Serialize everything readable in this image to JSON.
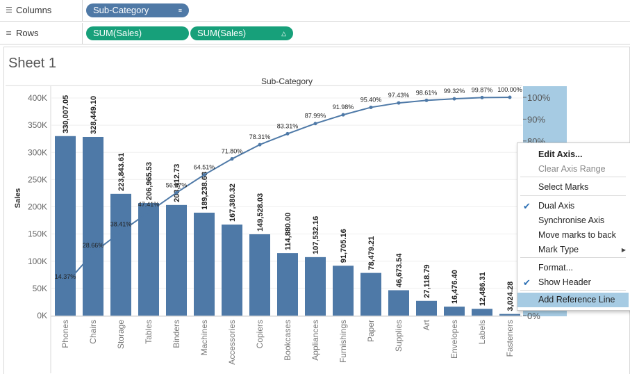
{
  "shelves": {
    "columns": {
      "label": "Columns",
      "icon": "columns-icon",
      "pills": [
        {
          "text": "Sub-Category",
          "icon": "sort-desc-icon"
        }
      ]
    },
    "rows": {
      "label": "Rows",
      "icon": "rows-icon",
      "pills": [
        {
          "text": "SUM(Sales)"
        },
        {
          "text": "SUM(Sales)",
          "icon": "triangle-icon"
        }
      ]
    }
  },
  "sheet": {
    "title": "Sheet 1"
  },
  "chart_data": {
    "type": "bar",
    "title": "Sub-Category",
    "ylabel": "Sales",
    "ylim": [
      0,
      400000
    ],
    "yticks": [
      "400K",
      "350K",
      "300K",
      "250K",
      "200K",
      "150K",
      "100K",
      "50K",
      "0K"
    ],
    "categories": [
      "Phones",
      "Chairs",
      "Storage",
      "Tables",
      "Binders",
      "Machines",
      "Accessories",
      "Copiers",
      "Bookcases",
      "Appliances",
      "Furnishings",
      "Paper",
      "Supplies",
      "Art",
      "Envelopes",
      "Labels",
      "Fasteners"
    ],
    "series": [
      {
        "values": [
          330007.05,
          328449.1,
          223843.61,
          206965.53,
          203412.73,
          189238.63,
          167380.32,
          149528.03,
          114880.0,
          107532.16,
          91705.16,
          78479.21,
          46673.54,
          27118.79,
          16476.4,
          12486.31,
          3024.28
        ],
        "labels": [
          "330,007.05",
          "328,449.10",
          "223,843.61",
          "206,965.53",
          "203,412.73",
          "189,238.63",
          "167,380.32",
          "149,528.03",
          "114,880.00",
          "107,532.16",
          "91,705.16",
          "78,479.21",
          "46,673.54",
          "27,118.79",
          "16,476.40",
          "12,486.31",
          "3,024.28"
        ]
      },
      {
        "values": [
          14.37,
          28.66,
          38.41,
          47.41,
          56.27,
          64.51,
          71.8,
          78.31,
          83.31,
          87.99,
          91.98,
          95.4,
          97.43,
          98.61,
          99.32,
          99.87,
          100.0
        ],
        "labels": [
          "14.37%",
          "28.66%",
          "38.41%",
          "47.41%",
          "56.27%",
          "64.51%",
          "71.80%",
          "78.31%",
          "83.31%",
          "87.99%",
          "91.98%",
          "95.40%",
          "97.43%",
          "98.61%",
          "99.32%",
          "99.87%",
          "100.00%"
        ]
      }
    ],
    "y2ticks": [
      "100%",
      "90%",
      "80%",
      "0%"
    ],
    "colors": {
      "bar": "#4e79a7",
      "line": "#4e79a7",
      "axis_selected": "#a6cbe3"
    }
  },
  "context_menu": {
    "items": [
      {
        "label": "Edit Axis...",
        "bold": true
      },
      {
        "label": "Clear Axis Range",
        "disabled": true
      },
      {
        "label": "Select Marks"
      },
      {
        "label": "Dual Axis",
        "checked": true
      },
      {
        "label": "Synchronise Axis"
      },
      {
        "label": "Move marks to back"
      },
      {
        "label": "Mark Type",
        "submenu": true
      },
      {
        "label": "Format..."
      },
      {
        "label": "Show Header",
        "checked": true
      },
      {
        "label": "Add Reference Line",
        "highlighted": true
      }
    ]
  }
}
